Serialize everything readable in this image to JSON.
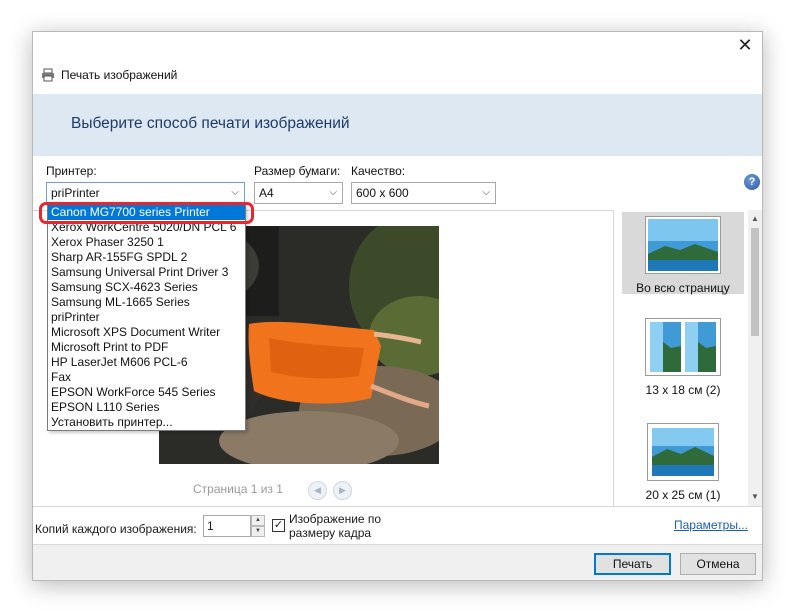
{
  "window": {
    "title": "Печать изображений",
    "close_glyph": "✕",
    "heading": "Выберите способ печати изображений"
  },
  "printer": {
    "label": "Принтер:",
    "value": "priPrinter",
    "options": [
      "Canon MG7700 series Printer",
      "Xerox WorkCentre 5020/DN PCL 6",
      "Xerox Phaser 3250 1",
      "Sharp AR-155FG SPDL 2",
      "Samsung Universal Print Driver 3",
      "Samsung SCX-4623 Series",
      "Samsung ML-1665 Series",
      "priPrinter",
      "Microsoft XPS Document Writer",
      "Microsoft Print to PDF",
      "HP LaserJet M606 PCL-6",
      "Fax",
      "EPSON WorkForce 545 Series",
      "EPSON L110 Series",
      "Установить принтер..."
    ],
    "highlighted_option": "Canon MG7700 series Printer"
  },
  "paper": {
    "label": "Размер бумаги:",
    "value": "A4"
  },
  "quality": {
    "label": "Качество:",
    "value": "600 x 600"
  },
  "help_glyph": "?",
  "preview": {
    "pager": "Страница 1 из 1"
  },
  "layouts": [
    {
      "caption": "Во всю страницу",
      "selected": true
    },
    {
      "caption": "13 x 18 см (2)",
      "selected": false
    },
    {
      "caption": "20 x 25 см (1)",
      "selected": false
    }
  ],
  "copies": {
    "label": "Копий каждого изображения:",
    "value": "1"
  },
  "fit": {
    "label": "Изображение по размеру кадра",
    "checked": true
  },
  "params_link": "Параметры...",
  "buttons": {
    "print": "Печать",
    "cancel": "Отмена"
  },
  "colors": {
    "highlight": "#0078d7",
    "ring": "#e8262c",
    "banner": "#dde8f3",
    "link": "#1a5fb4"
  }
}
